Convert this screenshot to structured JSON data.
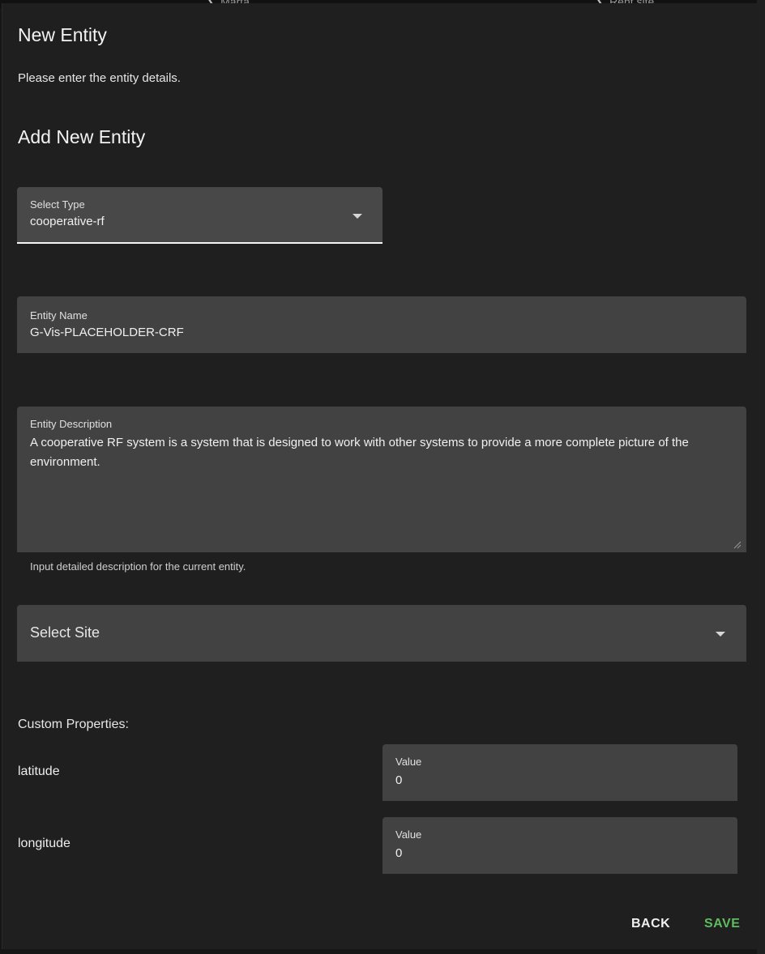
{
  "background": {
    "crumbs": [
      {
        "label": "Marta"
      },
      {
        "label": "Rent site"
      }
    ]
  },
  "dialog": {
    "title": "New Entity",
    "subtitle": "Please enter the entity details.",
    "section_title": "Add New Entity"
  },
  "form": {
    "type": {
      "label": "Select Type",
      "value": "cooperative-rf"
    },
    "name": {
      "label": "Entity Name",
      "value": "G-Vis-PLACEHOLDER-CRF"
    },
    "description": {
      "label": "Entity Description",
      "value": "A cooperative RF system is a system that is designed to work with other systems to provide a more complete picture of the environment.",
      "helper": "Input detailed description for the current entity."
    },
    "site": {
      "placeholder": "Select Site"
    },
    "custom_properties": {
      "title": "Custom Properties:",
      "items": [
        {
          "name": "latitude",
          "value_label": "Value",
          "value": "0"
        },
        {
          "name": "longitude",
          "value_label": "Value",
          "value": "0"
        }
      ]
    }
  },
  "actions": {
    "back": "BACK",
    "save": "SAVE"
  },
  "colors": {
    "dialog_bg": "#1f1f1f",
    "field_bg": "#424242",
    "save_accent": "#5fbb5f"
  },
  "icons": {
    "select_caret": "caret-down-icon",
    "crumb_chevron": "chevron-icon",
    "resize": "resize-grip-icon"
  }
}
